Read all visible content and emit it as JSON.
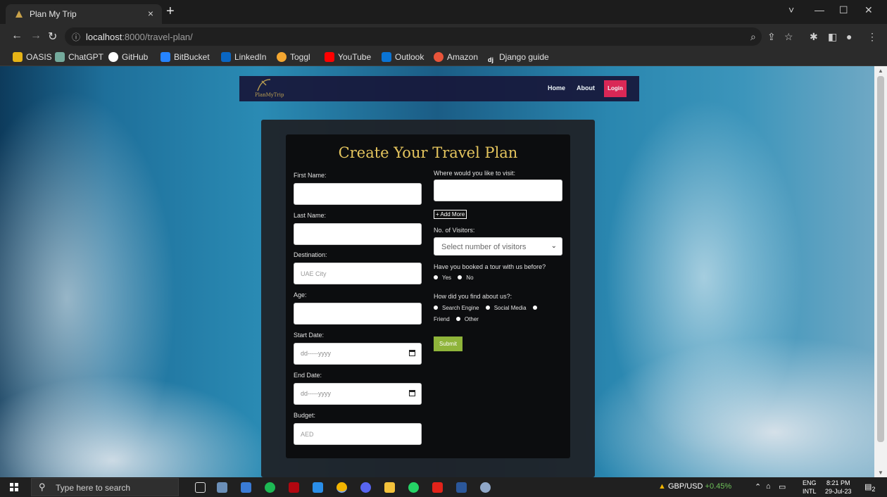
{
  "browser": {
    "tab_title": "Plan My Trip",
    "tab_close": "×",
    "new_tab": "+",
    "url_host": "localhost",
    "url_path": ":8000/travel-plan/",
    "window_controls": [
      "˅",
      "—",
      "☐",
      "✕"
    ],
    "bookmarks": [
      {
        "label": "OASIS",
        "icon": "oasis-icon",
        "color": "#e7b416"
      },
      {
        "label": "ChatGPT",
        "icon": "chatgpt-icon",
        "color": "#74aa9c"
      },
      {
        "label": "GitHub",
        "icon": "github-icon",
        "color": "#ffffff"
      },
      {
        "label": "BitBucket",
        "icon": "bitbucket-icon",
        "color": "#2684ff"
      },
      {
        "label": "LinkedIn",
        "icon": "linkedin-icon",
        "color": "#0a66c2"
      },
      {
        "label": "Toggl",
        "icon": "toggl-icon",
        "color": "#f4a731"
      },
      {
        "label": "YouTube",
        "icon": "youtube-icon",
        "color": "#ff0000"
      },
      {
        "label": "Outlook",
        "icon": "outlook-icon",
        "color": "#0a74d4"
      },
      {
        "label": "Amazon",
        "icon": "amazon-icon",
        "color": "#e8543a"
      },
      {
        "label": "Django guide",
        "icon": "django-icon",
        "color": "#2b2b2b"
      }
    ]
  },
  "site": {
    "logo_text": "PlanMyTrip",
    "nav_home": "Home",
    "nav_about": "About",
    "nav_login": "Login",
    "accent": "#e8204f"
  },
  "form": {
    "title": "Create Your Travel Plan",
    "first_name_label": "First Name:",
    "last_name_label": "Last Name:",
    "destination_label": "Destination:",
    "destination_placeholder": "UAE City",
    "age_label": "Age:",
    "start_date_label": "Start Date:",
    "start_date_placeholder": "dd-----yyyy",
    "end_date_label": "End Date:",
    "end_date_placeholder": "dd-----yyyy",
    "budget_label": "Budget:",
    "budget_placeholder": "AED",
    "visit_label": "Where would you like to visit:",
    "add_more": "+ Add More",
    "visitors_label": "No. of Visitors:",
    "visitors_select": "Select number of visitors",
    "booked_label": "Have you booked a tour with us before?",
    "booked_yes": "Yes",
    "booked_no": "No",
    "find_label": "How did you find about us?:",
    "find_options": [
      "Search Engine",
      "Social Media",
      "Friend",
      "Other"
    ],
    "submit": "Submit",
    "title_color": "#e5c55e",
    "submit_color": "#8fb43a"
  },
  "taskbar": {
    "search_placeholder": "Type here to search",
    "ticker_label": "GBP/USD",
    "ticker_change": "+0.45%",
    "lang_top": "ENG",
    "lang_bottom": "INTL",
    "time": "8:21 PM",
    "date": "29-Jul-23",
    "notifications": "2"
  }
}
